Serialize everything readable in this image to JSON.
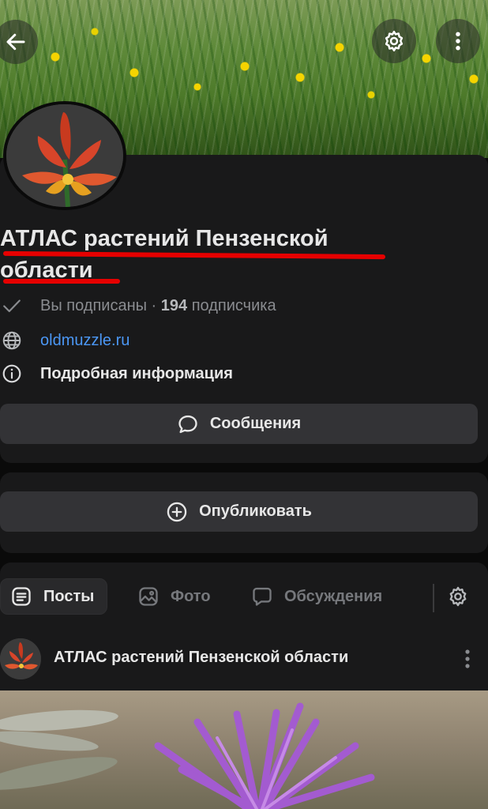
{
  "cover": {
    "back_icon": "arrow-left-icon",
    "settings_icon": "gear-icon",
    "more_icon": "more-vertical-icon"
  },
  "community": {
    "name_line1": "АТЛАС растений Пензенской",
    "name_line2": "области",
    "subscribed_text": "Вы подписаны",
    "separator": " · ",
    "subscribers_count": "194",
    "subscribers_label": " подписчика",
    "website": "oldmuzzle.ru",
    "details_label": "Подробная информация",
    "annotation_color": "#e60000"
  },
  "actions": {
    "messages_label": "Сообщения",
    "publish_label": "Опубликовать"
  },
  "tabs": [
    {
      "label": "Посты",
      "icon": "list-icon",
      "active": true
    },
    {
      "label": "Фото",
      "icon": "image-icon",
      "active": false
    },
    {
      "label": "Обсуждения",
      "icon": "chat-icon",
      "active": false
    }
  ],
  "tabs_settings_icon": "gear-icon",
  "post": {
    "author": "АТЛАС растений Пензенской области",
    "more_icon": "more-vertical-icon"
  },
  "colors": {
    "background": "#0a0a0a",
    "card": "#19191a",
    "button": "#333336",
    "link": "#4b97f5",
    "muted_text": "#8a8c90"
  }
}
